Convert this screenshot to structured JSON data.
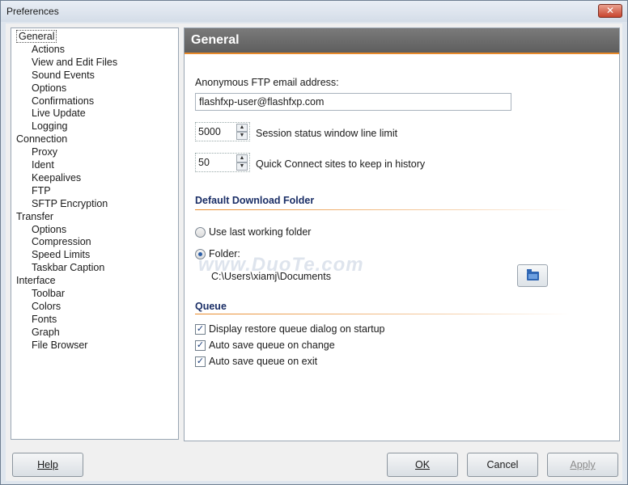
{
  "window": {
    "title": "Preferences",
    "close_glyph": "✕"
  },
  "tree": [
    {
      "label": "General",
      "level": 0,
      "selected": true
    },
    {
      "label": "Actions",
      "level": 1
    },
    {
      "label": "View and Edit Files",
      "level": 1
    },
    {
      "label": "Sound Events",
      "level": 1
    },
    {
      "label": "Options",
      "level": 1
    },
    {
      "label": "Confirmations",
      "level": 1
    },
    {
      "label": "Live Update",
      "level": 1
    },
    {
      "label": "Logging",
      "level": 1
    },
    {
      "label": "Connection",
      "level": 0
    },
    {
      "label": "Proxy",
      "level": 1
    },
    {
      "label": "Ident",
      "level": 1
    },
    {
      "label": "Keepalives",
      "level": 1
    },
    {
      "label": "FTP",
      "level": 1
    },
    {
      "label": "SFTP Encryption",
      "level": 1
    },
    {
      "label": "Transfer",
      "level": 0
    },
    {
      "label": "Options",
      "level": 1
    },
    {
      "label": "Compression",
      "level": 1
    },
    {
      "label": "Speed Limits",
      "level": 1
    },
    {
      "label": "Taskbar Caption",
      "level": 1
    },
    {
      "label": "Interface",
      "level": 0
    },
    {
      "label": "Toolbar",
      "level": 1
    },
    {
      "label": "Colors",
      "level": 1
    },
    {
      "label": "Fonts",
      "level": 1
    },
    {
      "label": "Graph",
      "level": 1
    },
    {
      "label": "File Browser",
      "level": 1
    }
  ],
  "panel": {
    "title": "General",
    "anon_email_label": "Anonymous FTP email address:",
    "anon_email_value": "flashfxp-user@flashfxp.com",
    "session_limit_value": "5000",
    "session_limit_label": "Session status window line limit",
    "quick_connect_value": "50",
    "quick_connect_label": "Quick Connect sites to keep in history",
    "download_section": "Default Download Folder",
    "use_last_label": "Use last working folder",
    "use_last_selected": false,
    "folder_label": "Folder:",
    "folder_selected": true,
    "folder_path": "C:\\Users\\xiamj\\Documents",
    "queue_section": "Queue",
    "queue_options": [
      {
        "label": "Display restore queue dialog on startup",
        "checked": true
      },
      {
        "label": "Auto save queue on change",
        "checked": true
      },
      {
        "label": "Auto save queue on exit",
        "checked": true
      }
    ]
  },
  "buttons": {
    "help": "Help",
    "ok": "OK",
    "cancel": "Cancel",
    "apply": "Apply"
  },
  "watermark": "www.DuoTe.com",
  "check_glyph": "✓"
}
